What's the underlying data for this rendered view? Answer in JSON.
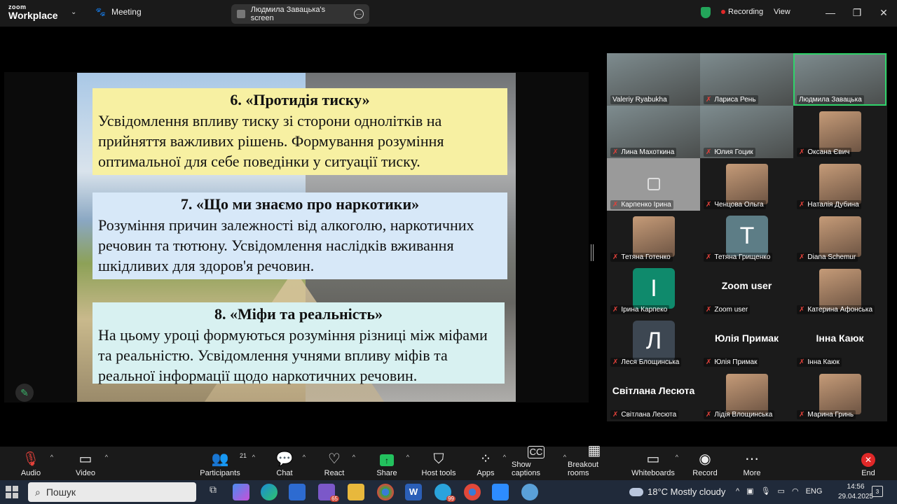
{
  "titlebar": {
    "logo_line1": "zoom",
    "logo_line2": "Workplace",
    "meeting_label": "Meeting",
    "screen_share_label": "Людмила Завацька's screen",
    "recording_label": "Recording",
    "view_label": "View"
  },
  "slide": {
    "section6": {
      "heading": "6. «Протидія тиску»",
      "body": "Усвідомлення впливу тиску зі сторони однолітків на прийняття важливих рішень. Формування розуміння оптимальної для себе поведінки у ситуації тиску."
    },
    "section7": {
      "heading": "7. «Що ми знаємо про наркотики»",
      "body": "Розуміння причин залежності від алкоголю, наркотичних речовин та тютюну. Усвідомлення наслідків вживання шкідливих для  здоров'я речовин."
    },
    "section8": {
      "heading": "8. «Міфи та реальність»",
      "body": "На  цьому уроці формуються розуміння різниці між міфами та реальністю. Усвідомлення учнями впливу міфів та реальної інформації щодо наркотичних речовин."
    }
  },
  "participants": [
    {
      "name": "Valeriy Ryabukha",
      "kind": "video",
      "muted": false
    },
    {
      "name": "Лариса Рень",
      "kind": "video",
      "muted": true
    },
    {
      "name": "Людмила Завацька",
      "kind": "video",
      "muted": false,
      "active": true
    },
    {
      "name": "Лина Махоткина",
      "kind": "video",
      "muted": true
    },
    {
      "name": "Юлия Гоцик",
      "kind": "video",
      "muted": true
    },
    {
      "name": "Оксана Євич",
      "kind": "photo",
      "muted": true
    },
    {
      "name": "Карпенко Ірина",
      "kind": "gray",
      "muted": true
    },
    {
      "name": "Ченцова Ольга",
      "kind": "photo",
      "muted": true
    },
    {
      "name": "Наталія Дубина",
      "kind": "photo",
      "muted": true
    },
    {
      "name": "Тетяна Готенко",
      "kind": "photo",
      "muted": true
    },
    {
      "name": "Тетяна Грищенко",
      "kind": "avatar",
      "letter": "T",
      "color": "#5d7d86",
      "muted": true
    },
    {
      "name": "Diana Schemur",
      "kind": "photo",
      "muted": true
    },
    {
      "name": "Ірина Карпеко",
      "kind": "avatar",
      "letter": "І",
      "color": "#0f8a6c",
      "muted": true
    },
    {
      "name": "Zoom user",
      "kind": "text",
      "big": "Zoom user",
      "muted": true
    },
    {
      "name": "Катерина Афонська",
      "kind": "photo",
      "muted": true
    },
    {
      "name": "Леся Блощинська",
      "kind": "avatar",
      "letter": "Л",
      "color": "#3d4752",
      "muted": true
    },
    {
      "name": "Юлія Примак",
      "kind": "text",
      "big": "Юлія Примак",
      "muted": true
    },
    {
      "name": "Інна Каюк",
      "kind": "text",
      "big": "Інна Каюк",
      "muted": true
    },
    {
      "name": "Світлана Лесюта",
      "kind": "text",
      "big": "Світлана Лесюта",
      "muted": true
    },
    {
      "name": "Лідія Влощинська",
      "kind": "photo",
      "muted": true
    },
    {
      "name": "Марина Гринь",
      "kind": "photo",
      "muted": true
    }
  ],
  "toolbar": {
    "audio": "Audio",
    "video": "Video",
    "participants": "Participants",
    "participants_count": "21",
    "chat": "Chat",
    "react": "React",
    "share": "Share",
    "host_tools": "Host tools",
    "apps": "Apps",
    "captions": "Show captions",
    "breakout": "Breakout rooms",
    "whiteboards": "Whiteboards",
    "record": "Record",
    "more": "More",
    "end": "End"
  },
  "taskbar": {
    "search_placeholder": "Пошук",
    "weather": "18°C  Mostly cloudy",
    "language": "ENG",
    "time": "14:56",
    "date": "29.04.2025",
    "badge_viber": "65",
    "badge_word": "99",
    "notif_count": "3"
  },
  "colors": {
    "accent_green": "#23c15e",
    "end_red": "#e02828",
    "box6_bg": "#f7f0a2",
    "box7_bg": "#d7e8f8",
    "box8_bg": "#d8f1f1"
  }
}
